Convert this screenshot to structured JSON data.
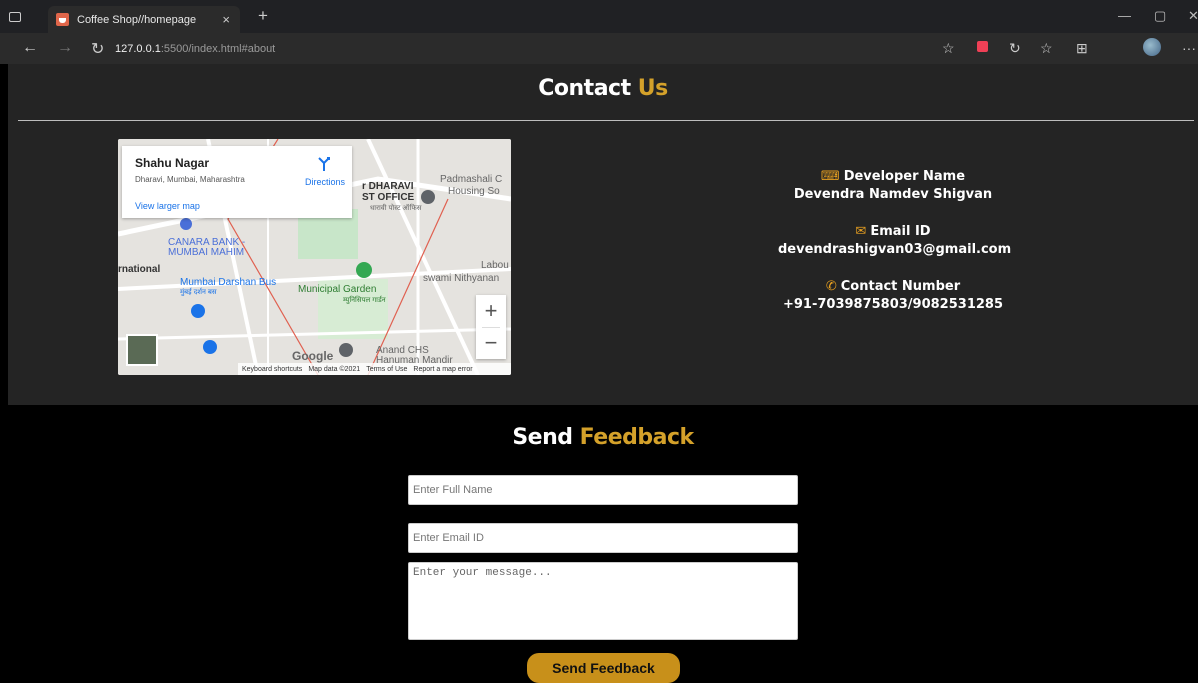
{
  "browser": {
    "tab_title": "Coffee Shop//homepage",
    "tab_close": "×",
    "new_tab": "+",
    "url_host": "127.0.0.1",
    "url_path": ":5500/index.html#about",
    "info_glyph": "i",
    "icons": [
      "sidebar-icon",
      "back-icon",
      "forward-icon",
      "refresh-icon",
      "favorite-icon",
      "pocket-icon",
      "extension-icon",
      "favorites-icon",
      "collections-icon",
      "profile-icon",
      "more-icon"
    ]
  },
  "contact": {
    "title_main": "Contact",
    "title_accent": "Us",
    "map": {
      "place": "Shahu Nagar",
      "address": "Dharavi, Mumbai, Maharashtra",
      "directions": "Directions",
      "larger_map": "View larger map",
      "labels": {
        "dharavi": "r DHARAVI",
        "post": "ST OFFICE",
        "post_local": "धारावी पोस्ट ऑफिस",
        "padmashali": "Padmashali C",
        "housing": "Housing So",
        "canara1": "CANARA BANK -",
        "canara2": "MUMBAI MAHIM",
        "national": "rnational",
        "labou": "Labou",
        "swami": "swami Nithyanan",
        "mumbai_darshan": "Mumbai Darshan Bus",
        "mumbai_darshan_local": "मुंबई दर्शन बस",
        "municipal": "Municipal Garden",
        "municipal_local": "म्युनिसिपल गार्डन",
        "anand": "Anand CHS",
        "hanuman": "Hanuman Mandir"
      },
      "google": "Google",
      "footer": [
        "Keyboard shortcuts",
        "Map data ©2021",
        "Terms of Use",
        "Report a map error"
      ],
      "zoom_in": "+",
      "zoom_out": "−"
    },
    "developer_label": "Developer Name",
    "developer_value": "Devendra Namdev Shigvan",
    "email_label": "Email ID",
    "email_value": "devendrashigvan03@gmail.com",
    "phone_label": "Contact Number",
    "phone_value": "+91-7039875803/9082531285"
  },
  "feedback": {
    "title_main": "Send",
    "title_accent": "Feedback",
    "name_placeholder": "Enter Full Name",
    "email_placeholder": "Enter Email ID",
    "message_placeholder": "Enter your message...",
    "submit_label": "Send Feedback"
  },
  "colors": {
    "accent": "#d4a12a",
    "button": "#c8901a",
    "icon": "#e8a020"
  }
}
